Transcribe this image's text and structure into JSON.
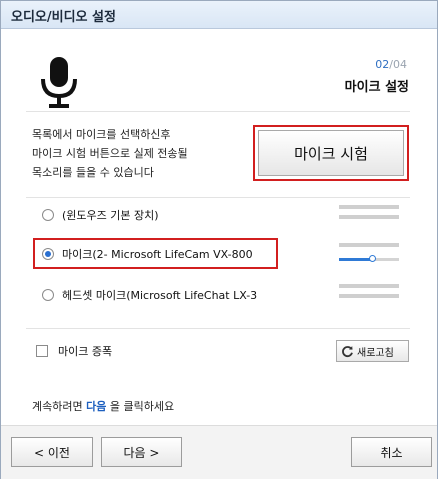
{
  "window": {
    "title": "오디오/비디오 설정"
  },
  "step": {
    "current": "02",
    "separator": "/",
    "total": "04"
  },
  "heading": "마이크 설정",
  "description": [
    "목록에서 마이크를 선택하신후",
    "마이크 시험 버튼으로 실제 전송될",
    "목소리를 들을 수 있습니다"
  ],
  "test_button_label": "마이크 시험",
  "devices": [
    {
      "label": "(윈도우즈 기본 장치)",
      "selected": false
    },
    {
      "label": "마이크(2- Microsoft LifeCam VX-800",
      "selected": true
    },
    {
      "label": "헤드셋 마이크(Microsoft LifeChat LX-3",
      "selected": false
    }
  ],
  "mic_volume": 0.55,
  "mic_boost": {
    "label": "마이크 증폭",
    "checked": false
  },
  "refresh_label": "새로고침",
  "hint": {
    "before": "계속하려면 ",
    "keyword": "다음",
    "after": " 을 클릭하세요"
  },
  "footer": {
    "prev_label": "< 이전",
    "next_label": "다음 >",
    "cancel_label": "취소"
  },
  "colors": {
    "accent": "#2f7ad6",
    "highlight": "#d21f1f"
  }
}
